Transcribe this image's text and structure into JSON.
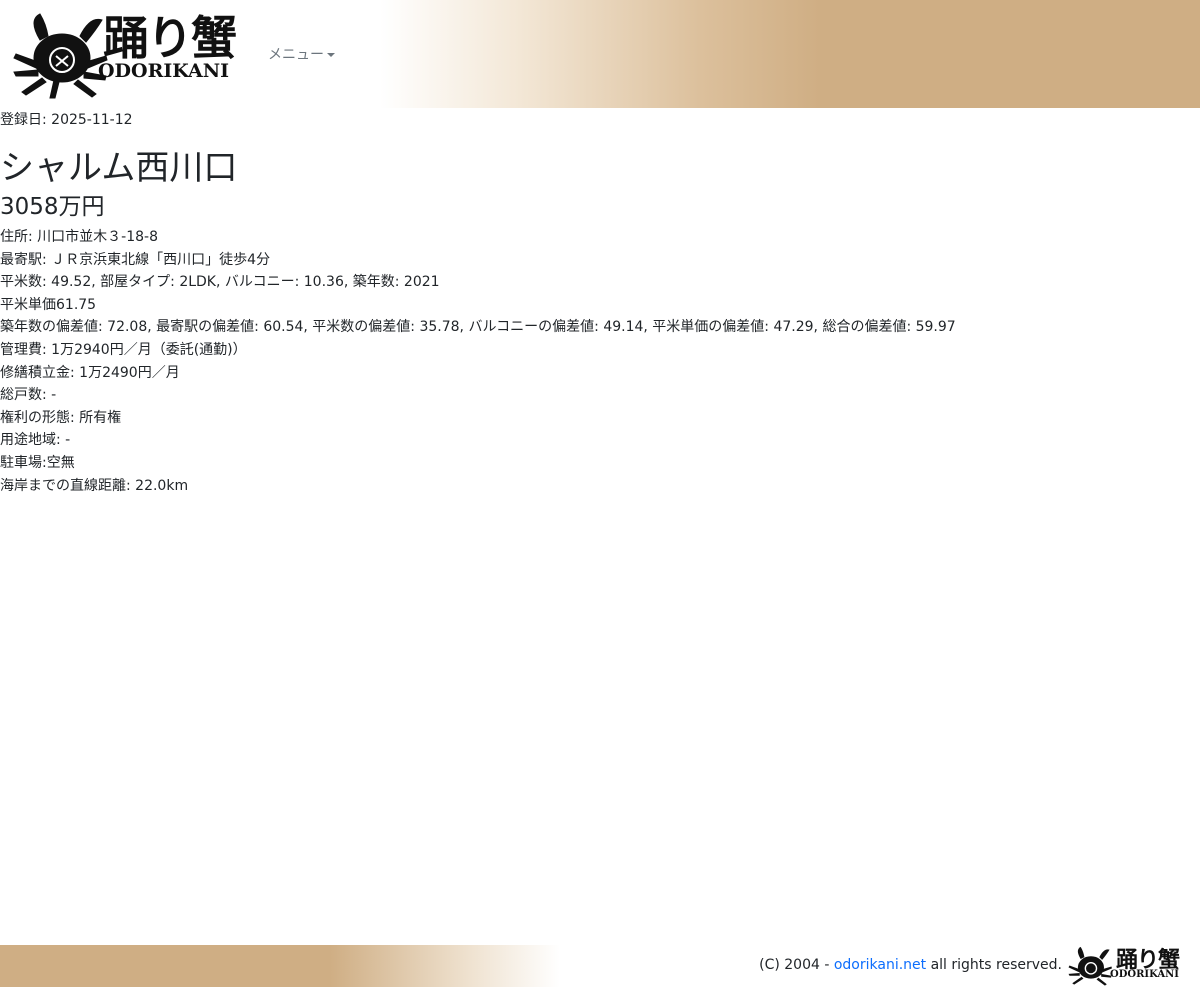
{
  "header": {
    "logo_jp": "踊り蟹",
    "logo_en": "ODORIKANI",
    "menu_label": "メニュー"
  },
  "listing": {
    "registered": "登録日: 2025-11-12",
    "name": "シャルム西川口",
    "price": "3058万円",
    "details": [
      "住所: 川口市並木３-18-8",
      "最寄駅: ＪＲ京浜東北線「西川口」徒歩4分",
      "平米数: 49.52, 部屋タイプ: 2LDK, バルコニー: 10.36, 築年数: 2021",
      "平米単価61.75",
      "築年数の偏差値: 72.08, 最寄駅の偏差値: 60.54, 平米数の偏差値: 35.78, バルコニーの偏差値: 49.14, 平米単価の偏差値: 47.29, 総合の偏差値: 59.97",
      "管理費: 1万2940円／月（委託(通勤)）",
      "修繕積立金: 1万2490円／月",
      "総戸数: -",
      "権利の形態: 所有権",
      "用途地域: -",
      "駐車場:空無",
      "海岸までの直線距離: 22.0km"
    ]
  },
  "footer": {
    "copyright_prefix": "(C) 2004 - ",
    "link_text": "odorikani.net",
    "copyright_suffix": " all rights reserved.",
    "logo_jp": "踊り蟹",
    "logo_en": "ODORIKANI"
  },
  "colors": {
    "gold": "#cfae84",
    "link": "#0d6efd",
    "menu": "#6c757d"
  }
}
